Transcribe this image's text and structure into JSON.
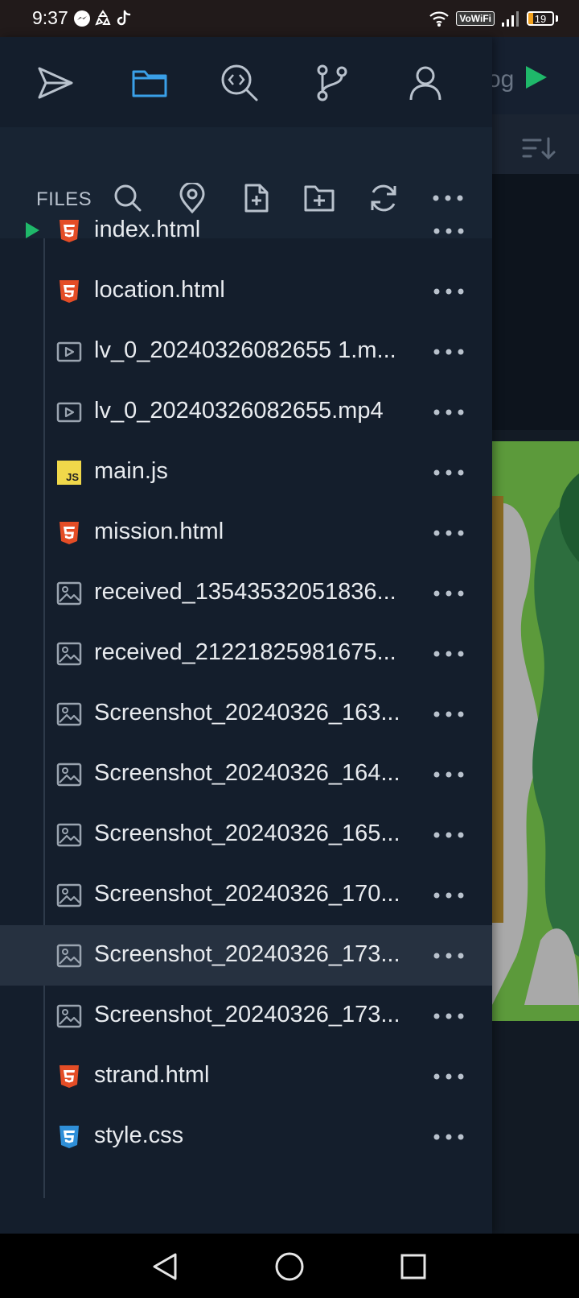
{
  "status_bar": {
    "time": "9:37",
    "vowifi": "VoWiFi",
    "battery": "19",
    "battery_level": 0.19,
    "icons": [
      "messenger-icon",
      "recycle-icon",
      "tiktok-icon",
      "wifi-icon",
      "signal-icon",
      "battery-icon"
    ]
  },
  "drawer": {
    "tabs": [
      "send-icon",
      "folder-icon",
      "code-search-icon",
      "git-branch-icon",
      "user-icon"
    ],
    "active_tab": "folder-icon",
    "files_label": "FILES",
    "toolbar_icons": [
      "search-icon",
      "location-pin-icon",
      "new-file-icon",
      "new-folder-icon",
      "refresh-icon",
      "more-icon"
    ]
  },
  "files": [
    {
      "name": "index.html",
      "type": "html",
      "running": true
    },
    {
      "name": "location.html",
      "type": "html"
    },
    {
      "name": "lv_0_20240326082655 1.m...",
      "type": "video"
    },
    {
      "name": "lv_0_20240326082655.mp4",
      "type": "video"
    },
    {
      "name": "main.js",
      "type": "js"
    },
    {
      "name": "mission.html",
      "type": "html"
    },
    {
      "name": "received_13543532051836...",
      "type": "image"
    },
    {
      "name": "received_21221825981675...",
      "type": "image"
    },
    {
      "name": "Screenshot_20240326_163...",
      "type": "image"
    },
    {
      "name": "Screenshot_20240326_164...",
      "type": "image"
    },
    {
      "name": "Screenshot_20240326_165...",
      "type": "image"
    },
    {
      "name": "Screenshot_20240326_170...",
      "type": "image"
    },
    {
      "name": "Screenshot_20240326_173...",
      "type": "image",
      "selected": true
    },
    {
      "name": "Screenshot_20240326_173...",
      "type": "image"
    },
    {
      "name": "strand.html",
      "type": "html"
    },
    {
      "name": "style.css",
      "type": "css"
    }
  ],
  "colors": {
    "accent": "#3aa0e8",
    "run_green": "#1fb86a",
    "html_icon": "#e44d26",
    "css_icon": "#2f8fd8",
    "js_icon": "#f0d84a"
  },
  "editor_peek": {
    "tab_text": "og"
  }
}
